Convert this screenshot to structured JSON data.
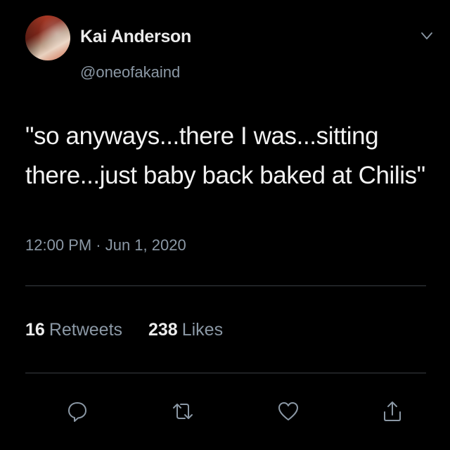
{
  "author": {
    "display_name": "Kai Anderson",
    "handle": "@oneofakaind",
    "avatar_icon": "avatar-photo"
  },
  "menu": {
    "icon": "chevron-down-icon"
  },
  "tweet": {
    "text": "\"so anyways...there I was...sitting there...just baby back baked at Chilis\"",
    "timestamp": "12:00 PM · Jun 1, 2020"
  },
  "stats": {
    "retweets_count": "16",
    "retweets_label": "Retweets",
    "likes_count": "238",
    "likes_label": "Likes"
  },
  "actions": [
    {
      "icon": "reply-icon"
    },
    {
      "icon": "retweet-icon"
    },
    {
      "icon": "like-icon"
    },
    {
      "icon": "share-icon"
    }
  ],
  "colors": {
    "background": "#000000",
    "primary_text": "#f2f2f2",
    "secondary_text": "#8b98a5",
    "divider": "#3a3f44"
  }
}
